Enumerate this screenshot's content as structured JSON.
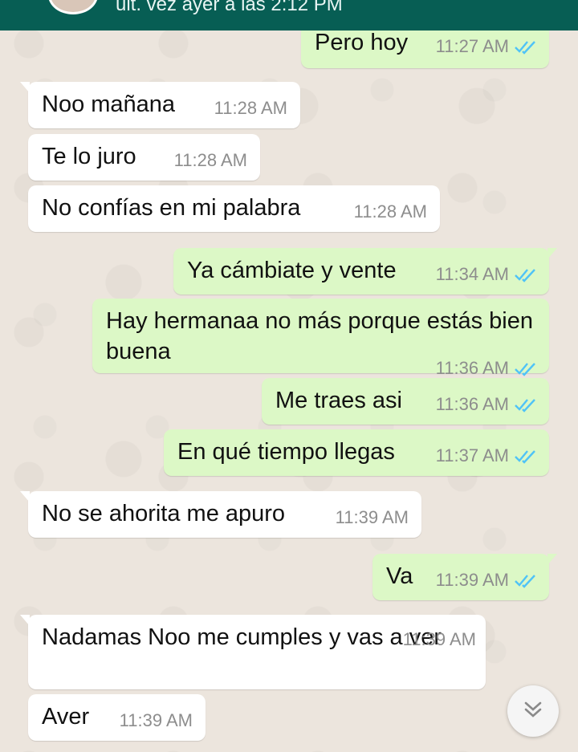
{
  "header": {
    "status": "ult. vez ayer a las 2:12 PM"
  },
  "messages": [
    {
      "dir": "out",
      "text": "Pero hoy",
      "time": "11:27 AM",
      "read": true
    },
    {
      "dir": "in",
      "text": "Noo mañana",
      "time": "11:28 AM"
    },
    {
      "dir": "in",
      "text": "Te lo juro",
      "time": "11:28 AM"
    },
    {
      "dir": "in",
      "text": "No confías en mi palabra",
      "time": "11:28 AM"
    },
    {
      "dir": "out",
      "text": "Ya cámbiate y vente",
      "time": "11:34 AM",
      "read": true
    },
    {
      "dir": "out",
      "text": "Hay hermanaa no más porque estás bien buena",
      "time": "11:36 AM",
      "read": true
    },
    {
      "dir": "out",
      "text": "Me traes asi",
      "time": "11:36 AM",
      "read": true
    },
    {
      "dir": "out",
      "text": "En qué tiempo llegas",
      "time": "11:37 AM",
      "read": true
    },
    {
      "dir": "in",
      "text": "No se ahorita me apuro",
      "time": "11:39 AM"
    },
    {
      "dir": "out",
      "text": "Va",
      "time": "11:39 AM",
      "read": true
    },
    {
      "dir": "in",
      "text": "Nadamas Noo me cumples y vas a ver",
      "time": "11:39 AM"
    },
    {
      "dir": "in",
      "text": "Aver",
      "time": "11:39 AM"
    }
  ],
  "colors": {
    "header": "#075e54",
    "outgoing_bubble": "#dcf8c6",
    "incoming_bubble": "#ffffff",
    "read_ticks": "#4fc3f7"
  },
  "icons": {
    "read_receipt": "double-check-icon",
    "scroll_down": "chevron-double-down-icon"
  }
}
